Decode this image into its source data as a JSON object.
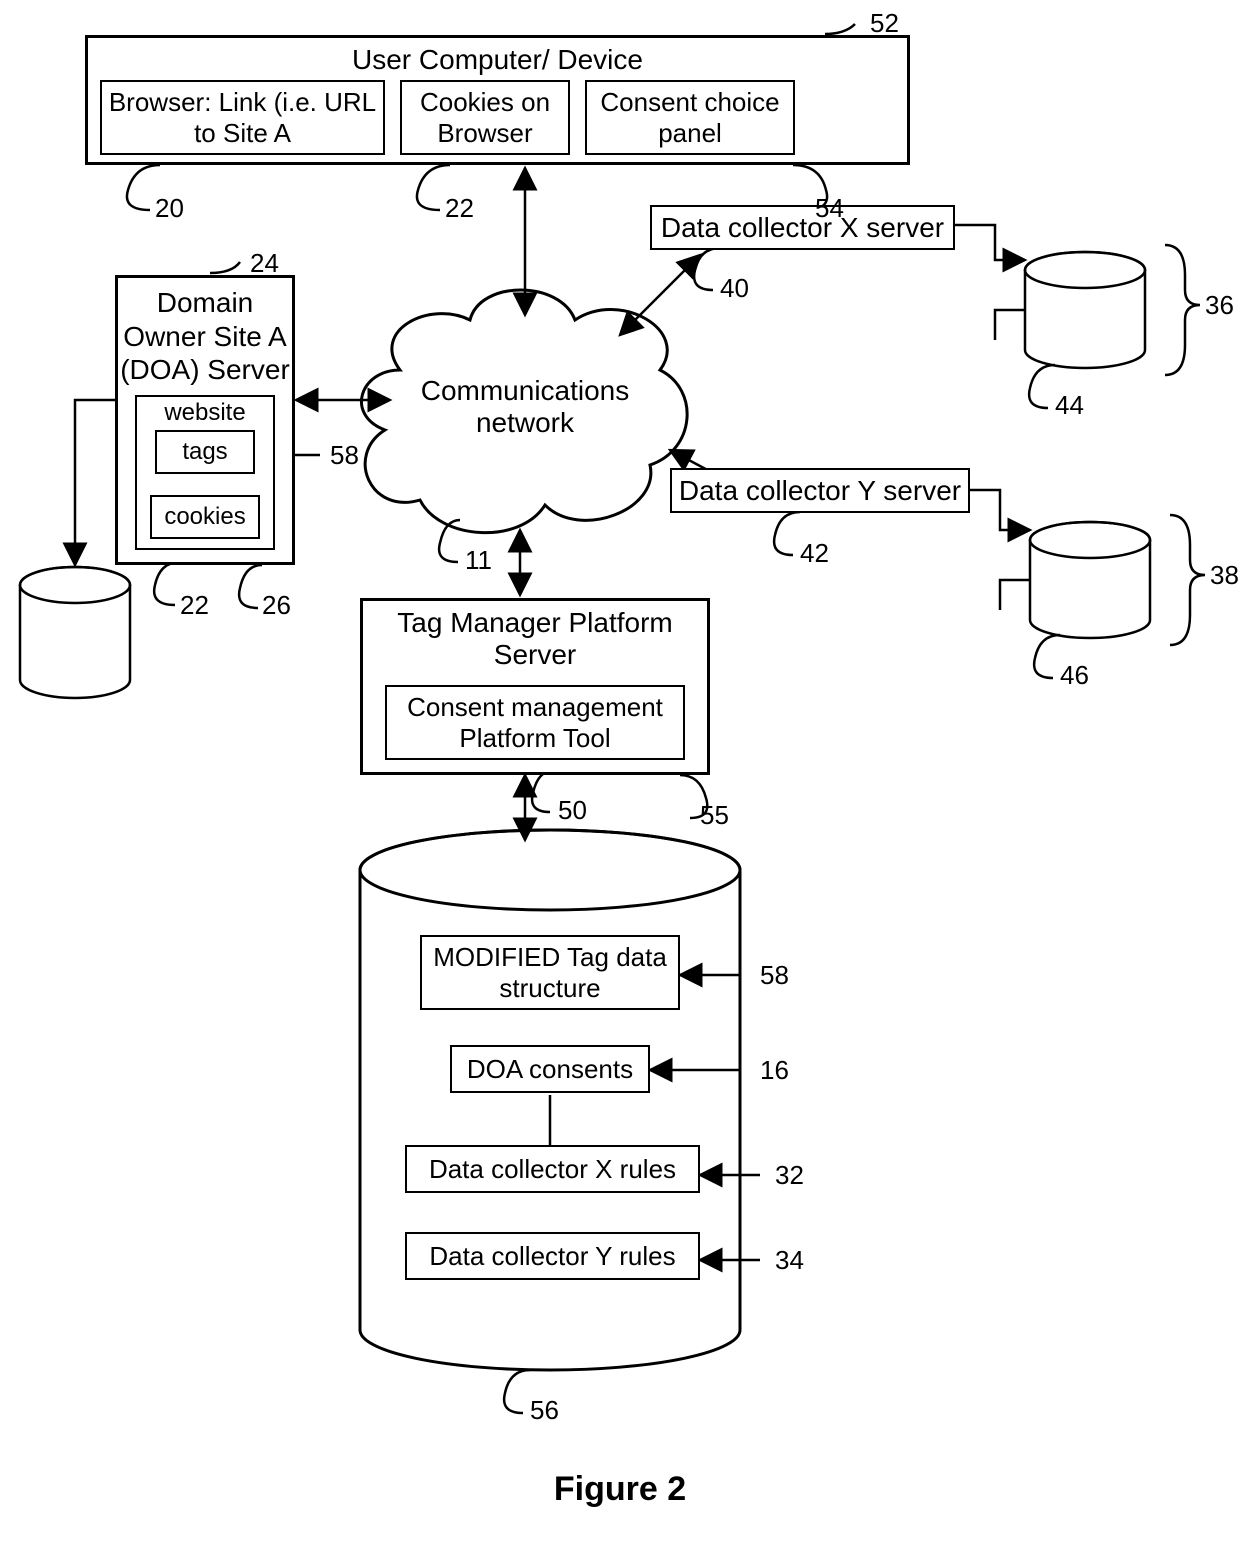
{
  "figure_title": "Figure 2",
  "user_device": {
    "title": "User Computer/ Device",
    "browser_link": "Browser: Link (i.e. URL to Site A",
    "cookies_browser": "Cookies on Browser",
    "consent_panel": "Consent choice panel"
  },
  "doa": {
    "title": "Domain Owner Site A (DOA) Server",
    "website": "website",
    "tags": "tags",
    "cookies": "cookies"
  },
  "cloud": "Communications network",
  "dcx": "Data collector X server",
  "dcy": "Data collector Y server",
  "tmp": {
    "title": "Tag Manager Platform Server",
    "tool": "Consent management Platform Tool"
  },
  "db": {
    "modified_tag": "MODIFIED Tag data structure",
    "doa_consents": "DOA consents",
    "dcx_rules": "Data collector X rules",
    "dcy_rules": "Data collector Y rules"
  },
  "refs": {
    "r52": "52",
    "r20": "20",
    "r22a": "22",
    "r54": "54",
    "r24": "24",
    "r58a": "58",
    "r22b": "22",
    "r26": "26",
    "r11": "11",
    "r40": "40",
    "r44": "44",
    "r36": "36",
    "r42": "42",
    "r46": "46",
    "r38": "38",
    "r50": "50",
    "r55": "55",
    "r56": "56",
    "r58b": "58",
    "r16": "16",
    "r32": "32",
    "r34": "34"
  }
}
